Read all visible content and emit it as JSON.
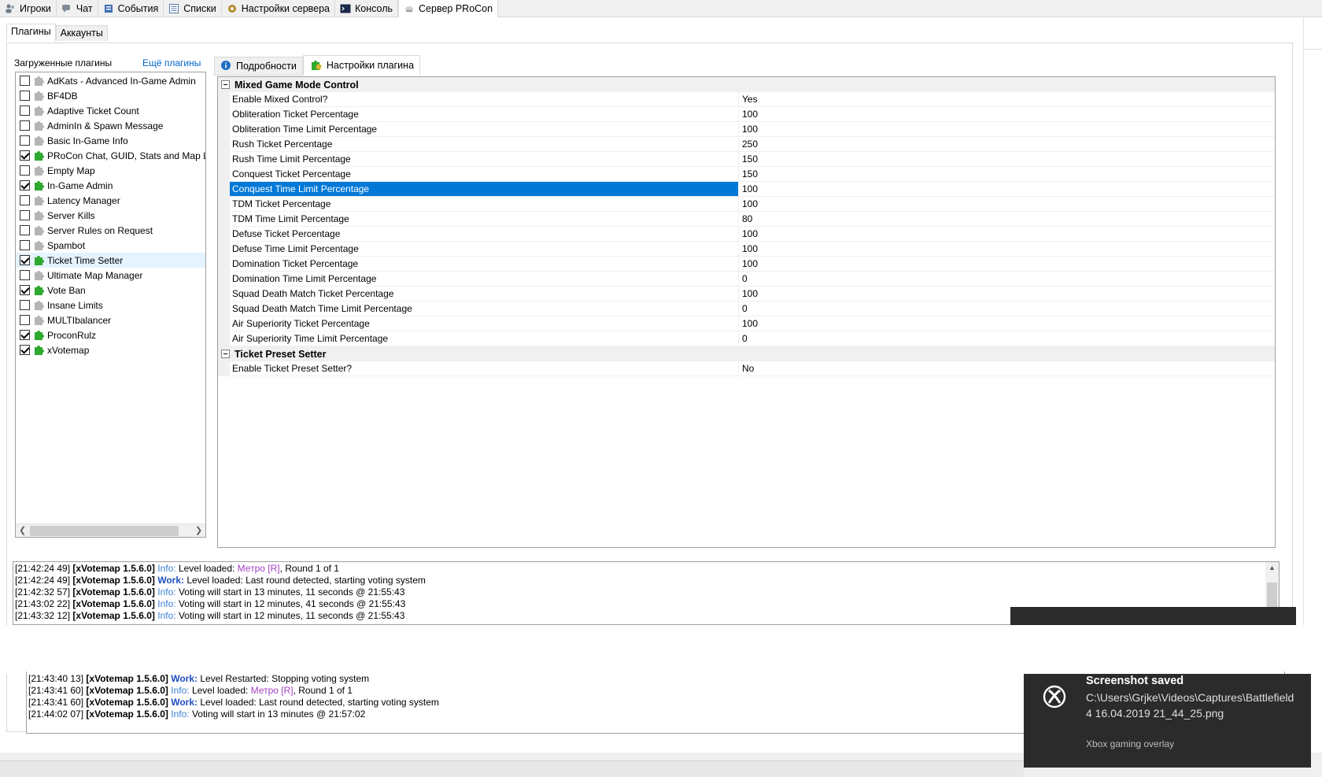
{
  "top_tabs": [
    {
      "label": "Игроки",
      "icon": "players-icon"
    },
    {
      "label": "Чат",
      "icon": "chat-icon"
    },
    {
      "label": "События",
      "icon": "events-icon"
    },
    {
      "label": "Списки",
      "icon": "lists-icon"
    },
    {
      "label": "Настройки сервера",
      "icon": "server-settings-icon"
    },
    {
      "label": "Консоль",
      "icon": "console-icon"
    },
    {
      "label": "Сервер PRoCon",
      "icon": "procon-server-icon",
      "active": true
    }
  ],
  "sub_tabs": [
    {
      "label": "Плагины",
      "active": true
    },
    {
      "label": "Аккаунты"
    }
  ],
  "plugins_pane": {
    "title": "Загруженные плагины",
    "more_link": "Ещё плагины",
    "items": [
      {
        "label": "AdKats - Advanced In-Game Admin",
        "checked": false
      },
      {
        "label": "BF4DB",
        "checked": false
      },
      {
        "label": "Adaptive Ticket Count",
        "checked": false
      },
      {
        "label": "AdminIn & Spawn Message",
        "checked": false
      },
      {
        "label": "Basic In-Game Info",
        "checked": false
      },
      {
        "label": "PRoCon Chat, GUID, Stats and Map Logger",
        "checked": true
      },
      {
        "label": "Empty Map",
        "checked": false
      },
      {
        "label": "In-Game Admin",
        "checked": true
      },
      {
        "label": "Latency Manager",
        "checked": false
      },
      {
        "label": "Server Kills",
        "checked": false
      },
      {
        "label": "Server Rules on Request",
        "checked": false
      },
      {
        "label": "Spambot",
        "checked": false
      },
      {
        "label": "Ticket Time Setter",
        "checked": true,
        "selected": true
      },
      {
        "label": "Ultimate Map Manager",
        "checked": false
      },
      {
        "label": "Vote Ban",
        "checked": true
      },
      {
        "label": "Insane Limits",
        "checked": false
      },
      {
        "label": "MULTIbalancer",
        "checked": false
      },
      {
        "label": "ProconRulz",
        "checked": true
      },
      {
        "label": "xVotemap",
        "checked": true
      }
    ]
  },
  "detail_tabs": [
    {
      "label": "Подробности",
      "icon": "info-icon"
    },
    {
      "label": "Настройки плагина",
      "icon": "plugin-settings-icon",
      "active": true
    }
  ],
  "settings_groups": [
    {
      "title": "Mixed Game Mode Control",
      "rows": [
        {
          "name": "Enable Mixed Control?",
          "value": "Yes"
        },
        {
          "name": "Obliteration Ticket Percentage",
          "value": "100"
        },
        {
          "name": "Obliteration Time Limit Percentage",
          "value": "100"
        },
        {
          "name": "Rush Ticket Percentage",
          "value": "250"
        },
        {
          "name": "Rush Time Limit Percentage",
          "value": "150"
        },
        {
          "name": "Conquest Ticket Percentage",
          "value": "150"
        },
        {
          "name": "Conquest Time Limit Percentage",
          "value": "100",
          "selected": true
        },
        {
          "name": "TDM Ticket Percentage",
          "value": "100"
        },
        {
          "name": "TDM Time Limit Percentage",
          "value": "80"
        },
        {
          "name": "Defuse Ticket Percentage",
          "value": "100"
        },
        {
          "name": "Defuse Time Limit Percentage",
          "value": "100"
        },
        {
          "name": "Domination Ticket Percentage",
          "value": "100"
        },
        {
          "name": "Domination Time Limit Percentage",
          "value": "0"
        },
        {
          "name": "Squad Death Match Ticket Percentage",
          "value": "100"
        },
        {
          "name": "Squad Death Match Time Limit Percentage",
          "value": "0"
        },
        {
          "name": "Air Superiority Ticket Percentage",
          "value": "100"
        },
        {
          "name": "Air Superiority Time Limit Percentage",
          "value": "0"
        }
      ]
    },
    {
      "title": "Ticket Preset Setter",
      "rows": [
        {
          "name": "Enable Ticket Preset Setter?",
          "value": "No"
        }
      ]
    }
  ],
  "log_top": [
    {
      "time": "[21:42:24 49]",
      "source": "[xVotemap 1.5.6.0]",
      "level": "Info:",
      "text": "Level loaded: ",
      "map": "Метро [R]",
      "rest": ", Round 1 of 1"
    },
    {
      "time": "[21:42:24 49]",
      "source": "[xVotemap 1.5.6.0]",
      "level": "Work:",
      "text": "Level loaded: Last round detected, starting voting system",
      "map": "",
      "rest": ""
    },
    {
      "time": "[21:42:32 57]",
      "source": "[xVotemap 1.5.6.0]",
      "level": "Info:",
      "text": "Voting will start in 13 minutes, 11 seconds @ 21:55:43",
      "map": "",
      "rest": ""
    },
    {
      "time": "[21:43:02 22]",
      "source": "[xVotemap 1.5.6.0]",
      "level": "Info:",
      "text": "Voting will start in 12 minutes, 41 seconds @ 21:55:43",
      "map": "",
      "rest": ""
    },
    {
      "time": "[21:43:32 12]",
      "source": "[xVotemap 1.5.6.0]",
      "level": "Info:",
      "text": "Voting will start in 12 minutes, 11 seconds @ 21:55:43",
      "map": "",
      "rest": ""
    }
  ],
  "log_bottom": [
    {
      "time": "[21:43:40 13]",
      "source": "[xVotemap 1.5.6.0]",
      "level": "Work:",
      "text": "Level Restarted: Stopping voting system",
      "map": "",
      "rest": ""
    },
    {
      "time": "[21:43:41 60]",
      "source": "[xVotemap 1.5.6.0]",
      "level": "Info:",
      "text": "Level loaded: ",
      "map": "Метро [R]",
      "rest": ", Round 1 of 1"
    },
    {
      "time": "[21:43:41 60]",
      "source": "[xVotemap 1.5.6.0]",
      "level": "Work:",
      "text": "Level loaded: Last round detected, starting voting system",
      "map": "",
      "rest": ""
    },
    {
      "time": "[21:44:02 07]",
      "source": "[xVotemap 1.5.6.0]",
      "level": "Info:",
      "text": "Voting will start in 13 minutes @ 21:57:02",
      "map": "",
      "rest": ""
    }
  ],
  "toast": {
    "title": "Screenshot saved",
    "path": "C:\\Users\\Grjke\\Videos\\Captures\\Battlefield 4 16.04.2019 21_44_25.png",
    "source": "Xbox gaming overlay",
    "icon": "xbox-icon"
  },
  "colors": {
    "selection": "#0078d7",
    "link": "#0066cc",
    "log_info": "#3b7fd6",
    "log_work": "#1f4fbf",
    "log_map": "#a33fc4",
    "toast_bg": "#2b2b2b"
  }
}
